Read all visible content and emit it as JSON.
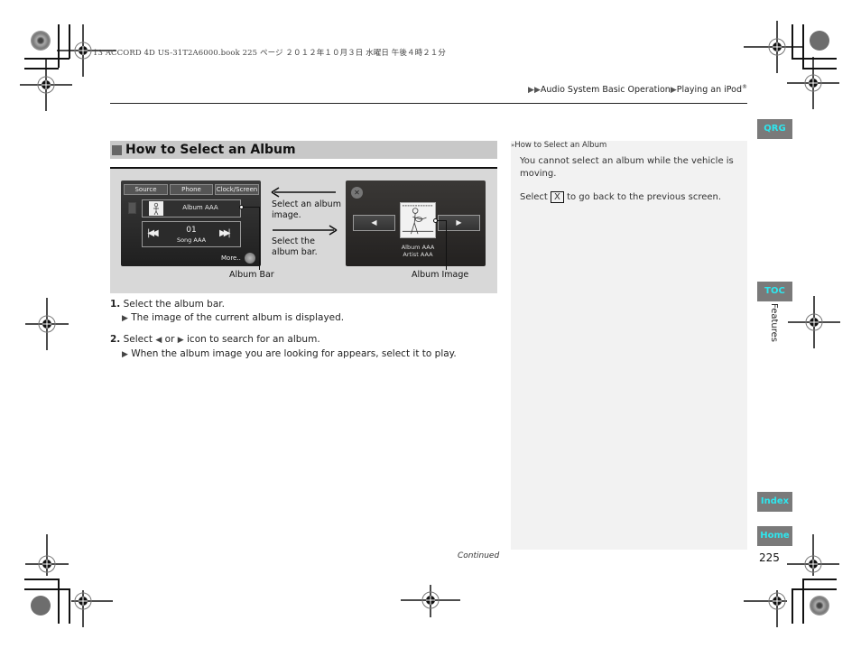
{
  "print_header": {
    "text": "13 ACCORD 4D US-31T2A6000.book  225 ページ  ２０１２年１０月３日  水曜日  午後４時２１分"
  },
  "breadcrumb": {
    "prefix_icon": "double-triangle-right-icon",
    "items": [
      "Audio System Basic Operation",
      "Playing an iPod"
    ],
    "separator_icon": "triangle-right-icon",
    "trademark": "®"
  },
  "section": {
    "title": "How to Select an Album"
  },
  "figure": {
    "screen1": {
      "tabs": [
        "Source",
        "Phone",
        "Clock/Screen"
      ],
      "album_bar_label": "Album AAA",
      "track_number": "01",
      "song_title": "Song AAA",
      "prev_icon": "skip-back-icon",
      "next_icon": "skip-forward-icon",
      "more_label": "More.."
    },
    "screen2": {
      "close_icon": "close-icon",
      "prev_icon": "left-arrow-icon",
      "next_icon": "right-arrow-icon",
      "album_name": "Album AAA",
      "artist_name": "Artist AAA"
    },
    "arrow_left_text": [
      "Select an album",
      "image."
    ],
    "arrow_right_text": [
      "Select the",
      "album bar."
    ],
    "label_album_bar": "Album Bar",
    "label_album_image": "Album Image"
  },
  "steps": [
    {
      "number": "1.",
      "text": "Select the album bar.",
      "result": "The image of the current album is displayed."
    },
    {
      "number": "2.",
      "text_before": "Select",
      "text_or": "or",
      "text_after": "icon to search for an album.",
      "result": "When the album image you are looking for appears, select it to play."
    }
  ],
  "side_note": {
    "title": "How to Select an Album",
    "paragraph1": "You cannot select an album while the vehicle is moving.",
    "paragraph2_before": "Select",
    "paragraph2_key": "X",
    "paragraph2_after": "to go back to the previous screen."
  },
  "nav_tabs": {
    "qrg": "QRG",
    "toc": "TOC",
    "index": "Index",
    "home": "Home",
    "chapter": "Features"
  },
  "footer": {
    "continued": "Continued",
    "page_number": "225"
  },
  "colors": {
    "nav_tab_bg": "#7a7a7a",
    "nav_tab_text": "#2ee6ee",
    "section_bar": "#c8c8c8",
    "side_panel": "#f2f2f2"
  }
}
